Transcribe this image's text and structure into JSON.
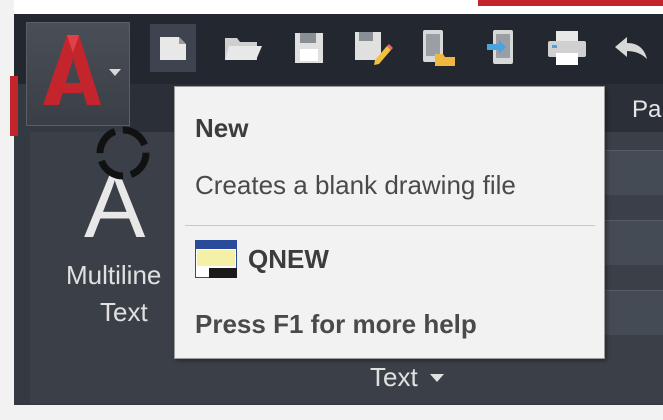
{
  "qat": {
    "buttons": [
      {
        "name": "new-icon"
      },
      {
        "name": "open-icon"
      },
      {
        "name": "save-icon"
      },
      {
        "name": "save-as-icon"
      },
      {
        "name": "open-from-mobile-icon"
      },
      {
        "name": "save-to-mobile-icon"
      },
      {
        "name": "plot-icon"
      },
      {
        "name": "undo-icon"
      }
    ],
    "active": "new-icon"
  },
  "ribbon": {
    "tab_partial": "Pa",
    "multiline_text_line1": "Multiline",
    "multiline_text_line2": "Text",
    "panel_title": "Text"
  },
  "tooltip": {
    "title": "New",
    "description": "Creates a blank drawing file",
    "command": "QNEW",
    "help": "Press F1 for more help"
  },
  "colors": {
    "app_logo": "#c4242b",
    "ribbon_bg": "#343a42",
    "tooltip_bg": "#f2f2f2"
  }
}
